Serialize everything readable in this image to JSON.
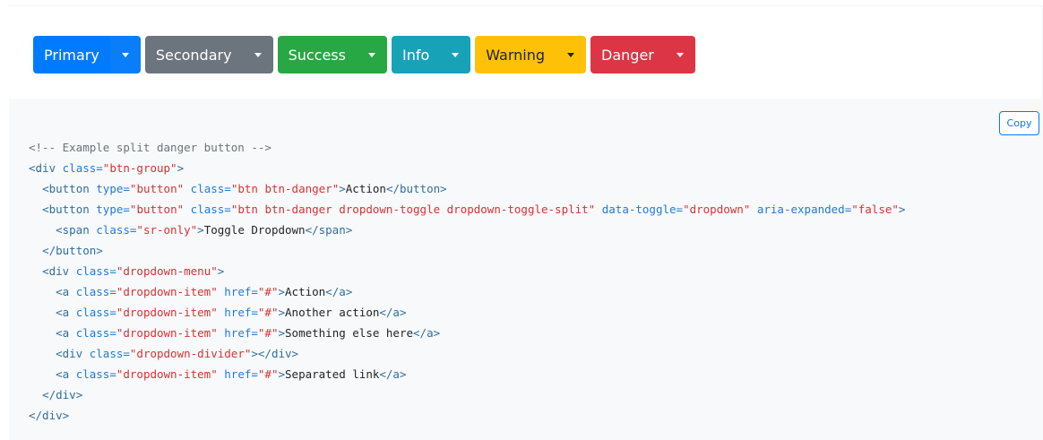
{
  "buttons": [
    {
      "label": "Primary",
      "variant": "primary",
      "color": "#007bff",
      "text_color": "#ffffff"
    },
    {
      "label": "Secondary",
      "variant": "secondary",
      "color": "#6c757d",
      "text_color": "#ffffff"
    },
    {
      "label": "Success",
      "variant": "success",
      "color": "#28a745",
      "text_color": "#ffffff"
    },
    {
      "label": "Info",
      "variant": "info",
      "color": "#17a2b8",
      "text_color": "#ffffff"
    },
    {
      "label": "Warning",
      "variant": "warning",
      "color": "#ffc107",
      "text_color": "#212529"
    },
    {
      "label": "Danger",
      "variant": "danger",
      "color": "#dc3545",
      "text_color": "#ffffff"
    }
  ],
  "copy_button": {
    "label": "Copy"
  },
  "code": {
    "lines": [
      [
        {
          "t": "comment",
          "s": "<!-- Example split danger button -->"
        }
      ],
      [
        {
          "t": "tag",
          "s": "<div "
        },
        {
          "t": "attr",
          "s": "class="
        },
        {
          "t": "val",
          "s": "\"btn-group\""
        },
        {
          "t": "tag",
          "s": ">"
        }
      ],
      [
        {
          "t": "text",
          "s": "  "
        },
        {
          "t": "tag",
          "s": "<button "
        },
        {
          "t": "attr",
          "s": "type="
        },
        {
          "t": "val",
          "s": "\"button\""
        },
        {
          "t": "text",
          "s": " "
        },
        {
          "t": "attr",
          "s": "class="
        },
        {
          "t": "val",
          "s": "\"btn btn-danger\""
        },
        {
          "t": "tag",
          "s": ">"
        },
        {
          "t": "text",
          "s": "Action"
        },
        {
          "t": "tag",
          "s": "</button>"
        }
      ],
      [
        {
          "t": "text",
          "s": "  "
        },
        {
          "t": "tag",
          "s": "<button "
        },
        {
          "t": "attr",
          "s": "type="
        },
        {
          "t": "val",
          "s": "\"button\""
        },
        {
          "t": "text",
          "s": " "
        },
        {
          "t": "attr",
          "s": "class="
        },
        {
          "t": "val",
          "s": "\"btn btn-danger dropdown-toggle dropdown-toggle-split\""
        },
        {
          "t": "text",
          "s": " "
        },
        {
          "t": "attr",
          "s": "data-toggle="
        },
        {
          "t": "val",
          "s": "\"dropdown\""
        },
        {
          "t": "text",
          "s": " "
        },
        {
          "t": "attr",
          "s": "aria-expanded="
        },
        {
          "t": "val",
          "s": "\"false\""
        },
        {
          "t": "tag",
          "s": ">"
        }
      ],
      [
        {
          "t": "text",
          "s": "    "
        },
        {
          "t": "tag",
          "s": "<span "
        },
        {
          "t": "attr",
          "s": "class="
        },
        {
          "t": "val",
          "s": "\"sr-only\""
        },
        {
          "t": "tag",
          "s": ">"
        },
        {
          "t": "text",
          "s": "Toggle Dropdown"
        },
        {
          "t": "tag",
          "s": "</span>"
        }
      ],
      [
        {
          "t": "text",
          "s": "  "
        },
        {
          "t": "tag",
          "s": "</button>"
        }
      ],
      [
        {
          "t": "text",
          "s": "  "
        },
        {
          "t": "tag",
          "s": "<div "
        },
        {
          "t": "attr",
          "s": "class="
        },
        {
          "t": "val",
          "s": "\"dropdown-menu\""
        },
        {
          "t": "tag",
          "s": ">"
        }
      ],
      [
        {
          "t": "text",
          "s": "    "
        },
        {
          "t": "tag",
          "s": "<a "
        },
        {
          "t": "attr",
          "s": "class="
        },
        {
          "t": "val",
          "s": "\"dropdown-item\""
        },
        {
          "t": "text",
          "s": " "
        },
        {
          "t": "attr",
          "s": "href="
        },
        {
          "t": "val",
          "s": "\"#\""
        },
        {
          "t": "tag",
          "s": ">"
        },
        {
          "t": "text",
          "s": "Action"
        },
        {
          "t": "tag",
          "s": "</a>"
        }
      ],
      [
        {
          "t": "text",
          "s": "    "
        },
        {
          "t": "tag",
          "s": "<a "
        },
        {
          "t": "attr",
          "s": "class="
        },
        {
          "t": "val",
          "s": "\"dropdown-item\""
        },
        {
          "t": "text",
          "s": " "
        },
        {
          "t": "attr",
          "s": "href="
        },
        {
          "t": "val",
          "s": "\"#\""
        },
        {
          "t": "tag",
          "s": ">"
        },
        {
          "t": "text",
          "s": "Another action"
        },
        {
          "t": "tag",
          "s": "</a>"
        }
      ],
      [
        {
          "t": "text",
          "s": "    "
        },
        {
          "t": "tag",
          "s": "<a "
        },
        {
          "t": "attr",
          "s": "class="
        },
        {
          "t": "val",
          "s": "\"dropdown-item\""
        },
        {
          "t": "text",
          "s": " "
        },
        {
          "t": "attr",
          "s": "href="
        },
        {
          "t": "val",
          "s": "\"#\""
        },
        {
          "t": "tag",
          "s": ">"
        },
        {
          "t": "text",
          "s": "Something else here"
        },
        {
          "t": "tag",
          "s": "</a>"
        }
      ],
      [
        {
          "t": "text",
          "s": "    "
        },
        {
          "t": "tag",
          "s": "<div "
        },
        {
          "t": "attr",
          "s": "class="
        },
        {
          "t": "val",
          "s": "\"dropdown-divider\""
        },
        {
          "t": "tag",
          "s": "></div>"
        }
      ],
      [
        {
          "t": "text",
          "s": "    "
        },
        {
          "t": "tag",
          "s": "<a "
        },
        {
          "t": "attr",
          "s": "class="
        },
        {
          "t": "val",
          "s": "\"dropdown-item\""
        },
        {
          "t": "text",
          "s": " "
        },
        {
          "t": "attr",
          "s": "href="
        },
        {
          "t": "val",
          "s": "\"#\""
        },
        {
          "t": "tag",
          "s": ">"
        },
        {
          "t": "text",
          "s": "Separated link"
        },
        {
          "t": "tag",
          "s": "</a>"
        }
      ],
      [
        {
          "t": "text",
          "s": "  "
        },
        {
          "t": "tag",
          "s": "</div>"
        }
      ],
      [
        {
          "t": "tag",
          "s": "</div>"
        }
      ]
    ]
  }
}
